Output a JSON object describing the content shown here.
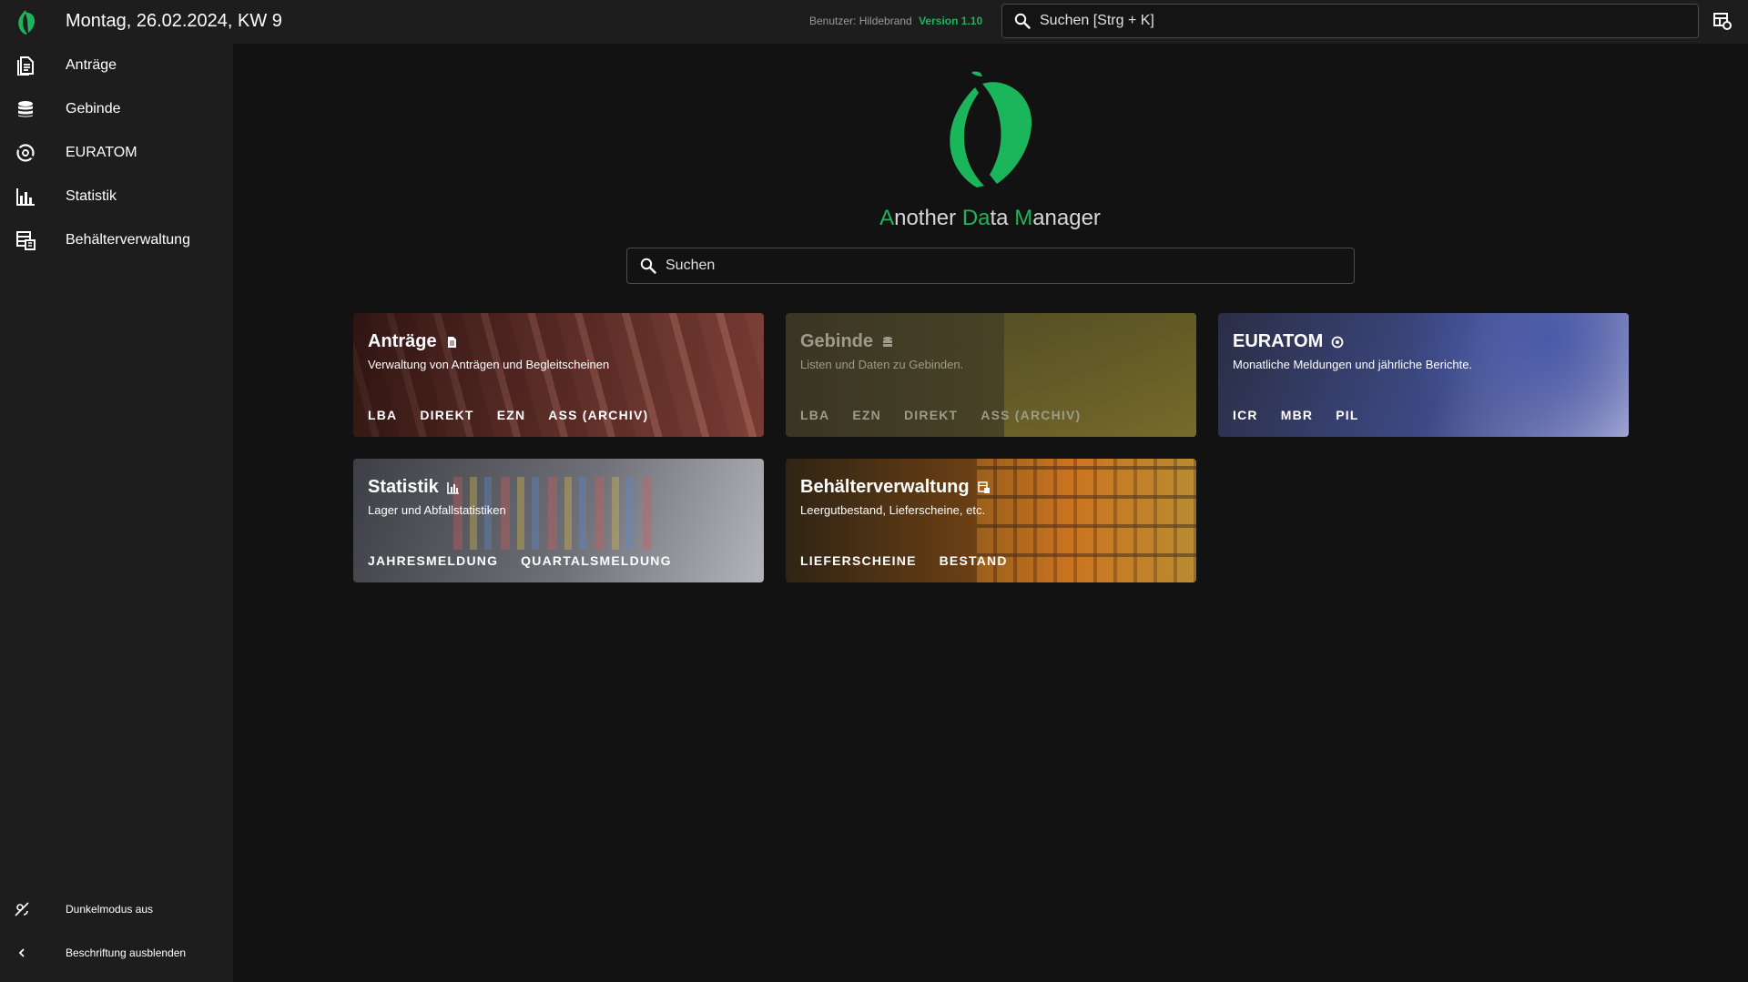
{
  "header": {
    "date": "Montag, 26.02.2024, KW 9",
    "user_label": "Benutzer: Hildebrand",
    "version": "Version 1.10",
    "search_placeholder": "Suchen [Strg + K]"
  },
  "sidebar": {
    "items": [
      {
        "label": "Anträge",
        "icon": "document-icon"
      },
      {
        "label": "Gebinde",
        "icon": "database-icon"
      },
      {
        "label": "EURATOM",
        "icon": "radioactive-icon"
      },
      {
        "label": "Statistik",
        "icon": "bar-chart-icon"
      },
      {
        "label": "Behälterverwaltung",
        "icon": "container-stack-icon"
      }
    ],
    "bottom": [
      {
        "label": "Dunkelmodus aus",
        "icon": "theme-toggle-icon"
      },
      {
        "label": "Beschriftung ausblenden",
        "icon": "chevron-left-icon"
      }
    ]
  },
  "hero": {
    "brand_parts": [
      {
        "text": "A",
        "accent": true
      },
      {
        "text": "nother ",
        "accent": false
      },
      {
        "text": "Da",
        "accent": true
      },
      {
        "text": "ta ",
        "accent": false
      },
      {
        "text": "M",
        "accent": true
      },
      {
        "text": "anager",
        "accent": false
      }
    ],
    "search_placeholder": "Suchen"
  },
  "cards": [
    {
      "title": "Anträge",
      "icon": "document-icon",
      "description": "Verwaltung von Anträgen und Begleitscheinen",
      "actions": [
        "LBA",
        "DIREKT",
        "EZN",
        "ASS (ARCHIV)"
      ]
    },
    {
      "title": "Gebinde",
      "icon": "database-icon",
      "description": "Listen und Daten zu Gebinden.",
      "actions": [
        "LBA",
        "EZN",
        "DIREKT",
        "ASS (ARCHIV)"
      ]
    },
    {
      "title": "EURATOM",
      "icon": "radioactive-icon",
      "description": "Monatliche Meldungen und jährliche Berichte.",
      "actions": [
        "ICR",
        "MBR",
        "PIL"
      ]
    },
    {
      "title": "Statistik",
      "icon": "bar-chart-icon",
      "description": "Lager und Abfallstatistiken",
      "actions": [
        "JAHRESMELDUNG",
        "QUARTALSMELDUNG"
      ]
    },
    {
      "title": "Behälterverwaltung",
      "icon": "container-stack-icon",
      "description": "Leergutbestand, Lieferscheine, etc.",
      "actions": [
        "LIEFERSCHEINE",
        "BESTAND"
      ]
    }
  ],
  "colors": {
    "accent": "#1bb55c",
    "background": "#121212",
    "sidebar": "#1d1d1d"
  }
}
